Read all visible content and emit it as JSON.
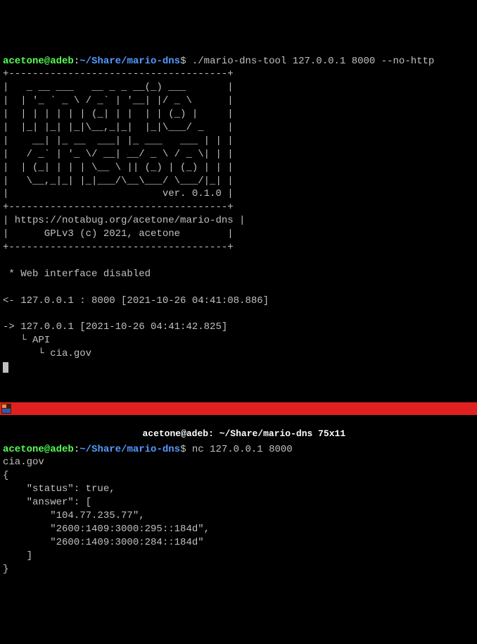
{
  "top": {
    "prompt": {
      "user": "acetone@adeb",
      "colon": ":",
      "path": "~/Share/mario-dns",
      "dollar": "$ "
    },
    "command": "./mario-dns-tool 127.0.0.1 8000 --no-http",
    "ascii_art": "+-------------------------------------+\n|   _ __ ___   __ _ _ __(_) ___       |\n|  | '_ ` _ \\ / _` | '__| |/ _ \\      |\n|  | | | | | | (_| | |  | | (_) |     |\n|  |_| |_| |_|\\__,_|_|  |_|\\___/ _    |\n|    __| |_ __  ___| |_ ___   ___ | | |\n|   / _` | '_ \\/ __| __/ _ \\ / _ \\| | |\n|  | (_| | | | \\__ \\ || (_) | (_) | | |\n|   \\__,_|_| |_|___/\\__\\___/ \\___/|_| |\n|                          ver. 0.1.0 |\n+-------------------------------------+\n| https://notabug.org/acetone/mario-dns |\n|      GPLv3 (c) 2021, acetone        |\n+-------------------------------------+",
    "status_line": " * Web interface disabled",
    "log1": "<- 127.0.0.1 : 8000 [2021-10-26 04:41:08.886]",
    "log2": "-> 127.0.0.1 [2021-10-26 04:41:42.825]",
    "tree1": "   └ API",
    "tree2": "      └ cia.gov"
  },
  "titlebar": {
    "text": "acetone@adeb: ~/Share/mario-dns 75x11"
  },
  "bottom": {
    "prompt": {
      "user": "acetone@adeb",
      "colon": ":",
      "path": "~/Share/mario-dns",
      "dollar": "$ "
    },
    "command": "nc 127.0.0.1 8000",
    "input_line": "cia.gov",
    "json_output": "{\n    \"status\": true,\n    \"answer\": [\n        \"104.77.235.77\",\n        \"2600:1409:3000:295::184d\",\n        \"2600:1409:3000:284::184d\"\n    ]\n}"
  }
}
